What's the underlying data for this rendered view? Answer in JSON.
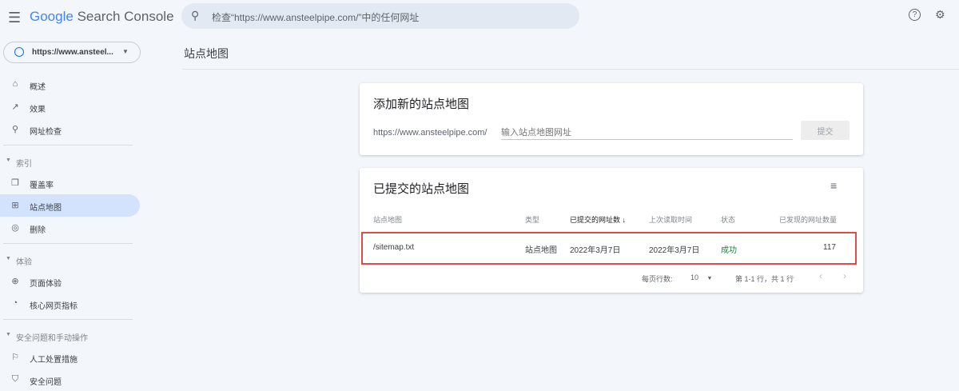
{
  "app": {
    "title_google": "Google",
    "title_rest": "Search Console",
    "search_placeholder": "检查“https://www.ansteelpipe.com/”中的任何网址",
    "property": "https://www.ansteel..."
  },
  "colors": {
    "g_blue": "#4285f4",
    "g_red": "#ea4335",
    "g_yellow": "#fbbc05",
    "g_green": "#34a853",
    "success": "#188038",
    "highlight": "#e04a4a"
  },
  "sidebar": {
    "items": [
      {
        "label": "概述",
        "icon": "home-icon"
      },
      {
        "label": "效果",
        "icon": "trending-icon"
      },
      {
        "label": "网址检查",
        "icon": "search-icon"
      }
    ],
    "sections": [
      {
        "label": "索引",
        "items": [
          {
            "label": "覆盖率"
          },
          {
            "label": "站点地图"
          },
          {
            "label": "删除"
          }
        ]
      },
      {
        "label": "体验",
        "items": [
          {
            "label": "页面体验"
          },
          {
            "label": "核心网页指标"
          }
        ]
      },
      {
        "label": "安全问题和手动操作",
        "items": [
          {
            "label": "人工处置措施"
          },
          {
            "label": "安全问题"
          }
        ]
      }
    ]
  },
  "page": {
    "title": "站点地图"
  },
  "add": {
    "title": "添加新的站点地图",
    "prefix": "https://www.ansteelpipe.com/",
    "placeholder": "输入站点地图网址",
    "submit": "提交"
  },
  "submitted": {
    "title": "已提交的站点地图",
    "columns": [
      "站点地图",
      "类型",
      "已提交的网址数",
      "上次读取时间",
      "状态",
      "已发现的网址数量"
    ],
    "sort_icon": "↓",
    "rows": [
      {
        "sitemap": "/sitemap.txt",
        "type": "站点地图",
        "submitted": "2022年3月7日",
        "last_read": "2022年3月7日",
        "status": "成功",
        "discovered": "117"
      }
    ],
    "rows_per_page_label": "每页行数:",
    "rows_per_page": "10",
    "range": "第 1-1 行，共 1 行"
  }
}
